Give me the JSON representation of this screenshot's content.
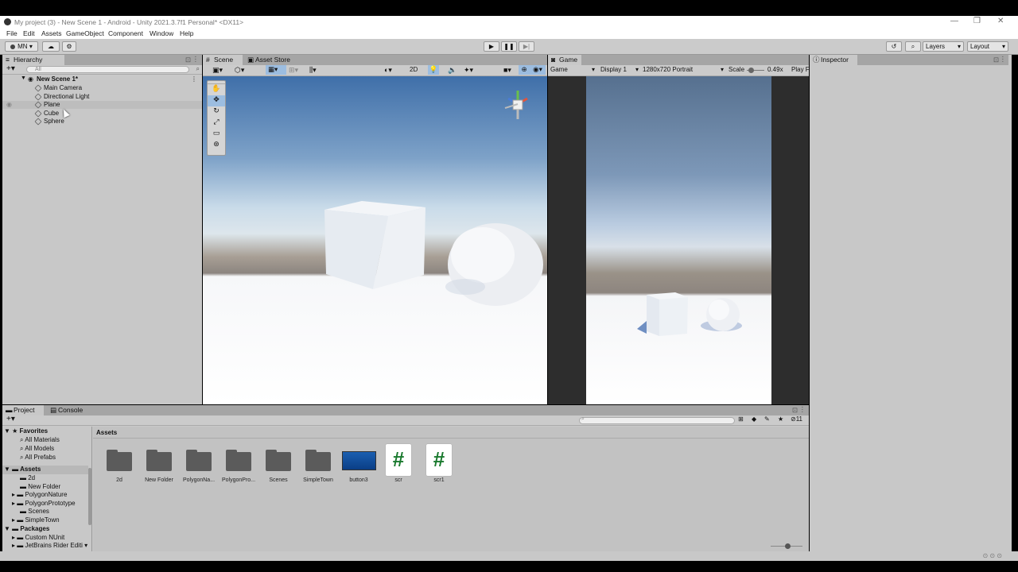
{
  "titlebar": {
    "title": "My project (3) - New Scene 1 - Android - Unity 2021.3.7f1 Personal* <DX11>",
    "min": "—",
    "max": "❐",
    "close": "✕"
  },
  "menu": [
    "File",
    "Edit",
    "Assets",
    "GameObject",
    "Component",
    "Window",
    "Help"
  ],
  "toolbar": {
    "account": "MN",
    "layers": "Layers",
    "layout": "Layout"
  },
  "hierarchy": {
    "tab": "Hierarchy",
    "search_placeholder": "All",
    "scene": "New Scene 1*",
    "items": [
      "Main Camera",
      "Directional Light",
      "Plane",
      "Cube",
      "Sphere"
    ]
  },
  "scene": {
    "tabs": [
      "Scene",
      "Asset Store"
    ],
    "mode_2d": "2D"
  },
  "game": {
    "tab": "Game",
    "view": "Game",
    "display": "Display 1",
    "resolution": "1280x720 Portrait",
    "scale_label": "Scale",
    "scale_value": "0.49x",
    "play": "Play F"
  },
  "inspector": {
    "tab": "Inspector"
  },
  "bottom": {
    "tabs": [
      "Project",
      "Console"
    ],
    "favorites": {
      "label": "Favorites",
      "items": [
        "All Materials",
        "All Models",
        "All Prefabs"
      ]
    },
    "assets_tree": {
      "label": "Assets",
      "items": [
        "2d",
        "New Folder",
        "PolygonNature",
        "PolygonPrototype",
        "Scenes",
        "SimpleTown"
      ]
    },
    "packages": {
      "label": "Packages",
      "items": [
        "Custom NUnit",
        "JetBrains Rider Editi"
      ]
    },
    "breadcrumb": "Assets",
    "hidden_count": "11",
    "grid": [
      {
        "label": "2d",
        "kind": "folder"
      },
      {
        "label": "New Folder",
        "kind": "folder"
      },
      {
        "label": "PolygonNa...",
        "kind": "folder"
      },
      {
        "label": "PolygonPro...",
        "kind": "folder"
      },
      {
        "label": "Scenes",
        "kind": "folder"
      },
      {
        "label": "SimpleTown",
        "kind": "folder"
      },
      {
        "label": "button3",
        "kind": "image"
      },
      {
        "label": "scr",
        "kind": "script"
      },
      {
        "label": "scr1",
        "kind": "script"
      }
    ],
    "script_glyph": "#"
  }
}
